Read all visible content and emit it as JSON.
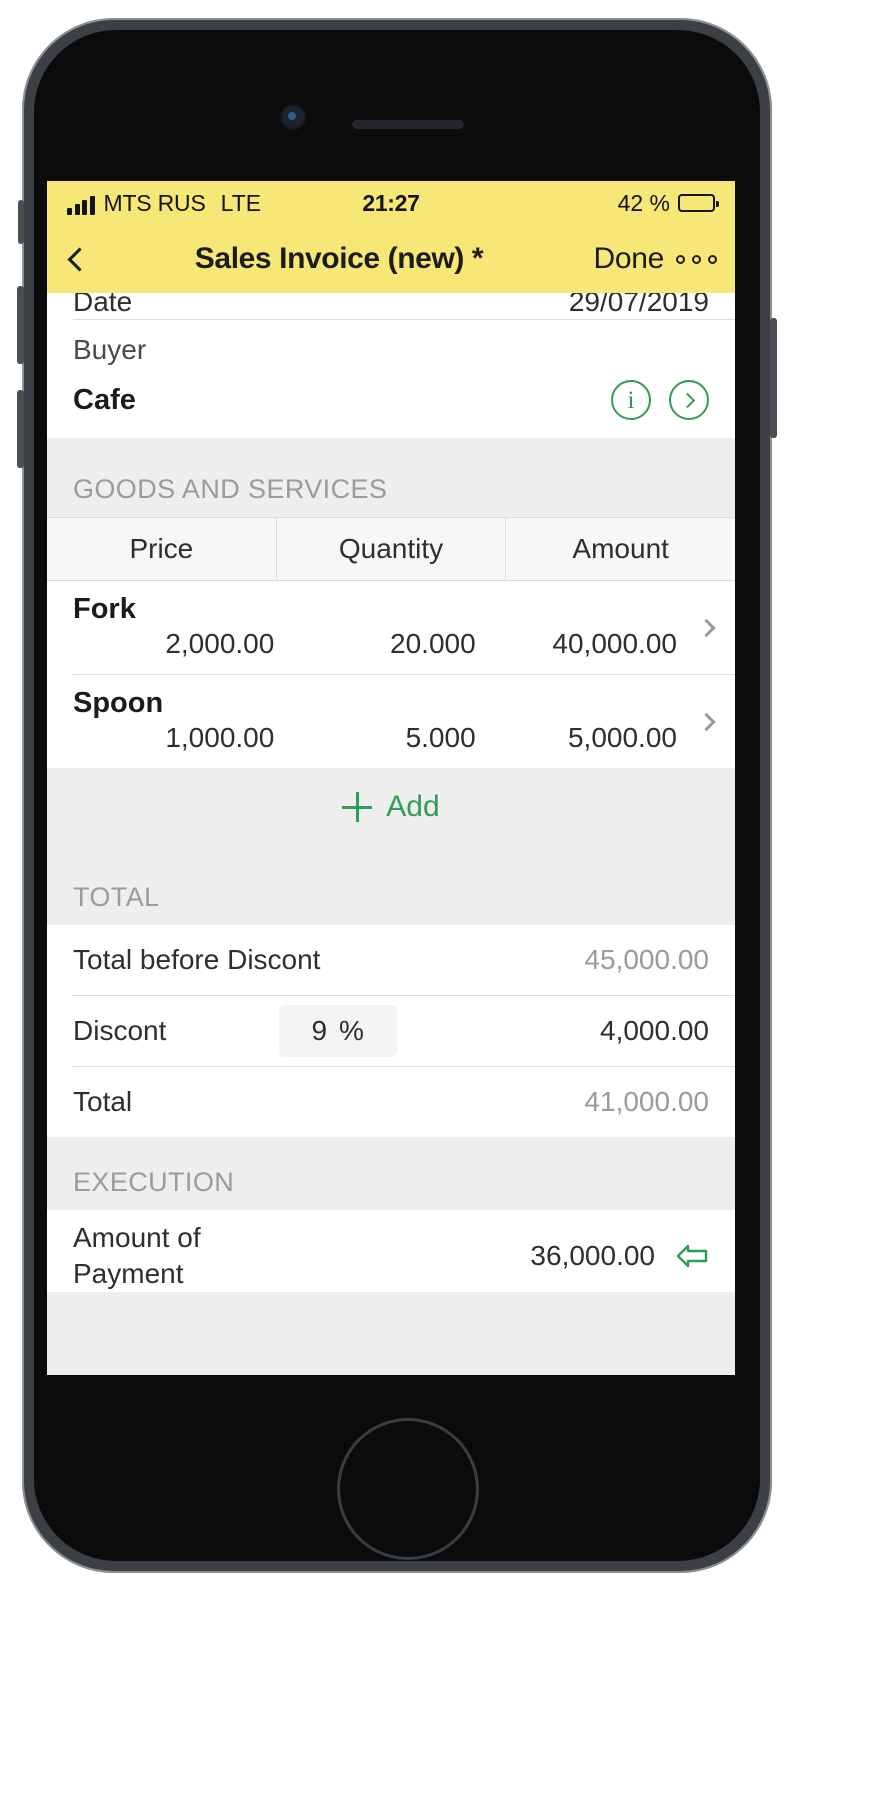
{
  "status_bar": {
    "signal_icon": "signal-bars-icon",
    "carrier": "MTS RUS",
    "network": "LTE",
    "time": "21:27",
    "battery_percent": "42 %",
    "battery_icon": "battery-icon",
    "battery_level": 42,
    "background_color": "#f7e777"
  },
  "nav_bar": {
    "back_icon": "chevron-left-icon",
    "title": "Sales Invoice (new) *",
    "done_label": "Done",
    "more_icon": "more-dots-icon",
    "background_color": "#f7e777"
  },
  "clipped_row": {
    "label": "Date",
    "value": "29/07/2019"
  },
  "buyer": {
    "caption": "Buyer",
    "name": "Cafe",
    "info_icon": "info-circle-icon",
    "info_glyph": "i",
    "open_icon": "chevron-right-circle-icon"
  },
  "goods": {
    "section_title": "GOODS AND SERVICES",
    "columns": [
      "Price",
      "Quantity",
      "Amount"
    ],
    "items": [
      {
        "name": "Fork",
        "price": "2,000.00",
        "quantity": "20.000",
        "amount": "40,000.00",
        "disclosure_icon": "chevron-right-icon"
      },
      {
        "name": "Spoon",
        "price": "1,000.00",
        "quantity": "5.000",
        "amount": "5,000.00",
        "disclosure_icon": "chevron-right-icon"
      }
    ],
    "add_label": "Add",
    "add_icon": "plus-icon",
    "accent_color": "#2f9e55"
  },
  "total": {
    "section_title": "TOTAL",
    "before_discount_label": "Total before Discont",
    "before_discount_value": "45,000.00",
    "discount_label": "Discont",
    "discount_percent": "9",
    "percent_sign": "%",
    "discount_amount": "4,000.00",
    "total_label": "Total",
    "total_value": "41,000.00"
  },
  "execution": {
    "section_title": "EXECUTION",
    "payment_label_line1": "Amount of",
    "payment_label_line2": "Payment",
    "payment_value": "36,000.00",
    "action_icon": "arrow-left-outline-icon"
  }
}
